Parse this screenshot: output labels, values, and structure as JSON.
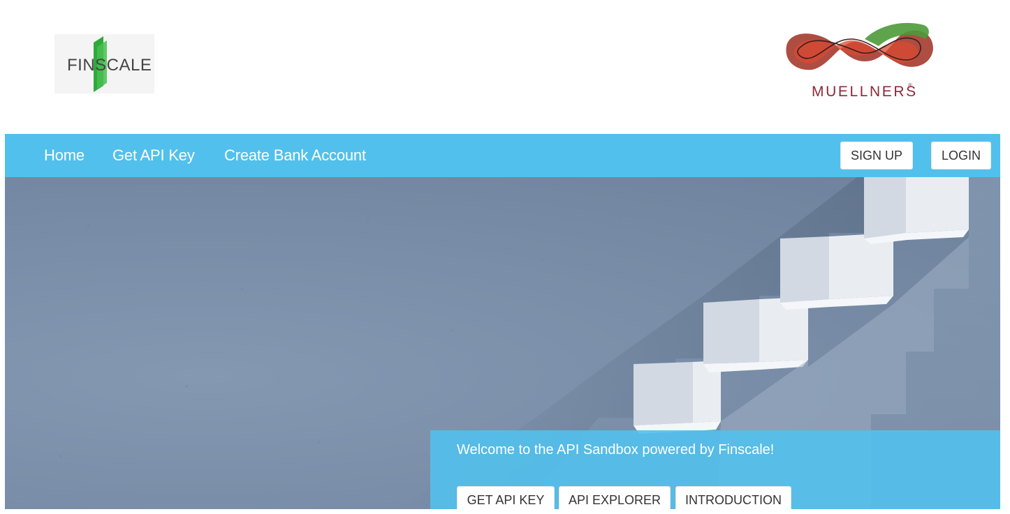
{
  "header": {
    "finscale_logo_text": "FINSCALE",
    "muellners_logo_text": "MUELLNERS",
    "muellners_reg_mark": "®"
  },
  "nav": {
    "links": [
      "Home",
      "Get API Key",
      "Create Bank Account"
    ],
    "signup_label": "SIGN UP",
    "login_label": "LOGIN"
  },
  "hero": {
    "welcome": "Welcome to the API Sandbox powered by Finscale!",
    "buttons": [
      "GET API KEY",
      "API EXPLORER",
      "INTRODUCTION"
    ]
  },
  "colors": {
    "nav_background": "#52c0ec",
    "hero_wall": "#7a8ea9",
    "finscale_green": "#2eaa3c",
    "muellners_red": "#8b2a3a"
  },
  "icons": {
    "finscale_logo": "finscale-logo",
    "muellners_logo": "muellners-infinity-logo"
  }
}
